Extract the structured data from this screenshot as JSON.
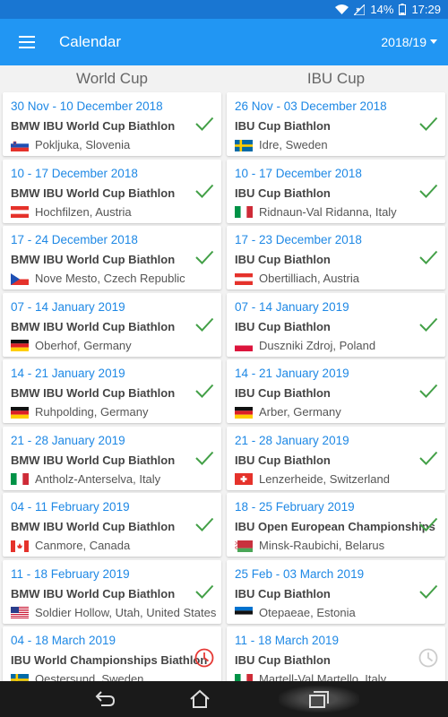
{
  "status_bar": {
    "battery": "14%",
    "time": "17:29"
  },
  "app_bar": {
    "title": "Calendar",
    "season": "2018/19"
  },
  "columns": {
    "left": "World Cup",
    "right": "IBU Cup"
  },
  "colors": {
    "primary": "#2196f3",
    "statusbar": "#1976d2",
    "date": "#1e88e5",
    "check": "#43a047",
    "live": "#e53935",
    "pending": "#cccccc"
  },
  "world_cup": [
    {
      "dates": "30 Nov - 10 December 2018",
      "name": "BMW IBU World Cup Biathlon",
      "location": "Pokljuka, Slovenia",
      "flag": "si",
      "status": "check-icon"
    },
    {
      "dates": "10 - 17 December 2018",
      "name": "BMW IBU World Cup Biathlon",
      "location": "Hochfilzen, Austria",
      "flag": "at",
      "status": "check-icon"
    },
    {
      "dates": "17 - 24 December 2018",
      "name": "BMW IBU World Cup Biathlon",
      "location": "Nove Mesto, Czech Republic",
      "flag": "cz",
      "status": "check-icon"
    },
    {
      "dates": "07 - 14 January 2019",
      "name": "BMW IBU World Cup Biathlon",
      "location": "Oberhof, Germany",
      "flag": "de",
      "status": "check-icon"
    },
    {
      "dates": "14 - 21 January 2019",
      "name": "BMW IBU World Cup Biathlon",
      "location": "Ruhpolding, Germany",
      "flag": "de",
      "status": "check-icon"
    },
    {
      "dates": "21 - 28 January 2019",
      "name": "BMW IBU World Cup Biathlon",
      "location": "Antholz-Anterselva, Italy",
      "flag": "it",
      "status": "check-icon"
    },
    {
      "dates": "04 - 11 February 2019",
      "name": "BMW IBU World Cup Biathlon",
      "location": "Canmore, Canada",
      "flag": "ca",
      "status": "check-icon"
    },
    {
      "dates": "11 - 18 February 2019",
      "name": "BMW IBU World Cup Biathlon",
      "location": "Soldier Hollow, Utah, United States",
      "flag": "us",
      "status": "check-icon"
    },
    {
      "dates": "04 - 18 March 2019",
      "name": "IBU World Championships Biathlon",
      "location": "Oestersund, Sweden",
      "flag": "se",
      "status": "clock-live-icon"
    }
  ],
  "ibu_cup": [
    {
      "dates": "26 Nov - 03 December 2018",
      "name": "IBU Cup Biathlon",
      "location": "Idre, Sweden",
      "flag": "se",
      "status": "check-icon"
    },
    {
      "dates": "10 - 17 December 2018",
      "name": "IBU Cup Biathlon",
      "location": "Ridnaun-Val Ridanna, Italy",
      "flag": "it",
      "status": "check-icon"
    },
    {
      "dates": "17 - 23 December 2018",
      "name": "IBU Cup Biathlon",
      "location": "Obertilliach, Austria",
      "flag": "at",
      "status": "check-icon"
    },
    {
      "dates": "07 - 14 January 2019",
      "name": "IBU Cup Biathlon",
      "location": "Duszniki Zdroj, Poland",
      "flag": "pl",
      "status": "check-icon"
    },
    {
      "dates": "14 - 21 January 2019",
      "name": "IBU Cup Biathlon",
      "location": "Arber, Germany",
      "flag": "de",
      "status": "check-icon"
    },
    {
      "dates": "21 - 28 January 2019",
      "name": "IBU Cup Biathlon",
      "location": "Lenzerheide, Switzerland",
      "flag": "ch",
      "status": "check-icon"
    },
    {
      "dates": "18 - 25 February 2019",
      "name": "IBU Open European Championships",
      "location": "Minsk-Raubichi, Belarus",
      "flag": "by",
      "status": "check-icon"
    },
    {
      "dates": "25 Feb - 03 March 2019",
      "name": "IBU Cup Biathlon",
      "location": "Otepaeae, Estonia",
      "flag": "ee",
      "status": "check-icon"
    },
    {
      "dates": "11 - 18 March 2019",
      "name": "IBU Cup Biathlon",
      "location": "Martell-Val Martello, Italy",
      "flag": "it",
      "status": "clock-pending-icon"
    }
  ]
}
